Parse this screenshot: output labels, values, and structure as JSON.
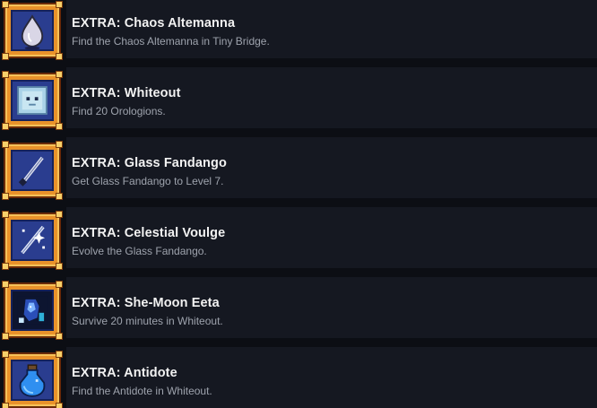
{
  "achievements": [
    {
      "title": "EXTRA: Chaos Altemanna",
      "description": "Find the Chaos Altemanna in Tiny Bridge.",
      "icon": "gem-drop-icon"
    },
    {
      "title": "EXTRA: Whiteout",
      "description": "Find 20 Orologions.",
      "icon": "ghost-icon"
    },
    {
      "title": "EXTRA: Glass Fandango",
      "description": "Get Glass Fandango to Level 7.",
      "icon": "sword-icon"
    },
    {
      "title": "EXTRA: Celestial Voulge",
      "description": "Evolve the Glass Fandango.",
      "icon": "sparkle-sword-icon"
    },
    {
      "title": "EXTRA: She-Moon Eeta",
      "description": "Survive 20 minutes in Whiteout.",
      "icon": "character-portrait-icon"
    },
    {
      "title": "EXTRA: Antidote",
      "description": "Find the Antidote in Whiteout.",
      "icon": "potion-icon"
    }
  ]
}
